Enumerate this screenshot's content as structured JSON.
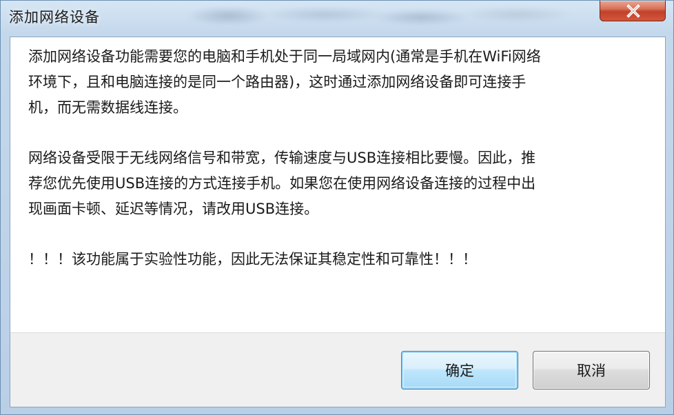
{
  "window": {
    "title": "添加网络设备"
  },
  "message": {
    "paragraph1": [
      "添加网络设备功能需要您的电脑和手机处于同一局域网内(通常是手机在WiFi网络",
      "环境下，且和电脑连接的是同一个路由器)，这时通过添加网络设备即可连接手",
      "机，而无需数据线连接。"
    ],
    "paragraph2": [
      "网络设备受限于无线网络信号和带宽，传输速度与USB连接相比要慢。因此，推",
      "荐您优先使用USB连接的方式连接手机。如果您在使用网络设备连接的过程中出",
      "现画面卡顿、延迟等情况，请改用USB连接。"
    ],
    "warning": "！！！该功能属于实验性功能，因此无法保证其稳定性和可靠性！！！"
  },
  "buttons": {
    "ok_label": "确定",
    "cancel_label": "取消"
  },
  "icons": {
    "close": "close-icon"
  },
  "colors": {
    "close_button": "#c1412a",
    "default_button_border": "#3c7fb1"
  }
}
